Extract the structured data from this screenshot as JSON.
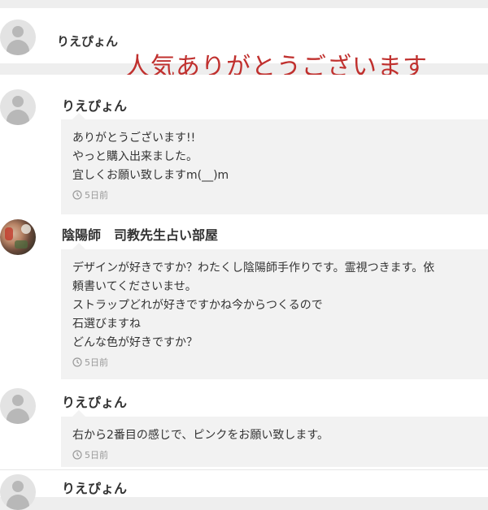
{
  "top_comment": {
    "username": "りえぴょん",
    "overlay_text": "人気ありがとうございます",
    "overlay_color": "#c0302e"
  },
  "comments": [
    {
      "username": "りえぴょん",
      "lines": [
        "ありがとうございます!!",
        "やっと購入出来ました。",
        "宜しくお願い致しますm(__)m"
      ],
      "time": "5日前"
    },
    {
      "username": "陰陽師　司教先生占い部屋",
      "lines": [
        "デザインが好きですか？わたくし陰陽師手作りです。霊視つきます。依",
        "頼書いてくださいませ。",
        "ストラップどれが好きですかね今からつくるので",
        "石選びますね",
        "どんな色が好きですか？"
      ],
      "time": "5日前"
    },
    {
      "username": "りえぴょん",
      "lines": [
        "右から2番目の感じで、ピンクをお願い致します。"
      ],
      "time": "5日前"
    },
    {
      "username": "りえぴょん"
    }
  ],
  "icons": {
    "avatar": "default-user-avatar-icon",
    "time": "clock-icon"
  }
}
